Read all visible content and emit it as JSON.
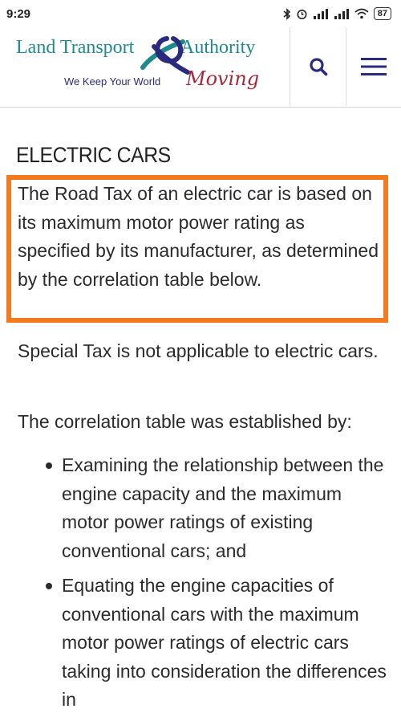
{
  "status_bar": {
    "time": "9:29",
    "battery": "87",
    "icons": [
      "bluetooth-icon",
      "alarm-icon",
      "signal-icon",
      "signal-icon",
      "wifi-icon",
      "battery-icon"
    ]
  },
  "header": {
    "logo": {
      "title_left": "Land Transport",
      "title_right": "Authority",
      "tagline": "We Keep Your World",
      "tagline_script": "Moving"
    },
    "search_icon": "search-icon",
    "menu_icon": "hamburger-menu-icon"
  },
  "content": {
    "title": "ELECTRIC CARS",
    "paragraph_1": "The Road Tax of an electric car is based on its maximum motor power rating as specified by its manufacturer, as determined by the correlation table below.",
    "paragraph_2": "Special Tax is not applicable to electric cars.",
    "paragraph_3": "The correlation table was established by:",
    "bullets": [
      "Examining the relationship between the engine capacity and the maximum motor power ratings of existing conventional cars; and",
      "Equating the engine capacities of conventional cars with the maximum motor power ratings of electric cars taking into consideration the differences in"
    ]
  },
  "colors": {
    "highlight_border": "#f47a20",
    "brand_teal": "#1d8a8f",
    "brand_navy": "#2a2b7e",
    "brand_red": "#a52a3c"
  }
}
